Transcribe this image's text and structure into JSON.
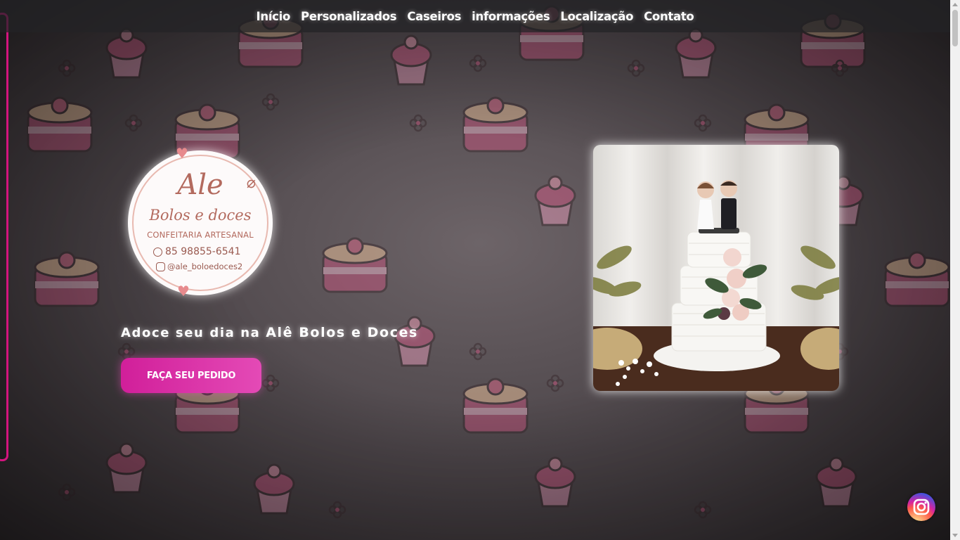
{
  "nav": {
    "items": [
      {
        "label": "Início"
      },
      {
        "label": "Personalizados"
      },
      {
        "label": "Caseiros"
      },
      {
        "label": "informações"
      },
      {
        "label": "Localização"
      },
      {
        "label": "Contato"
      }
    ]
  },
  "logo": {
    "name": "Ale",
    "subtitle": "Bolos e doces",
    "tagline": "CONFEITARIA ARTESANAL",
    "phone": "85 98855-6541",
    "instagram": "@ale_boloedoces2",
    "icons": [
      "heart-icon",
      "whisk-icon",
      "whatsapp-icon",
      "instagram-icon"
    ]
  },
  "hero": {
    "heading_prefix": "Adoce seu dia na ",
    "heading_brand": "Alê Bolos e Doces",
    "cta_label": "FAÇA SEU PEDIDO"
  },
  "floating": {
    "icon": "instagram-icon"
  },
  "colors": {
    "accent": "#d11f9a",
    "accent_light": "#e44ab6",
    "logo_text": "#b36a5e",
    "nav_bg": "#232326",
    "side_border": "#d4147e"
  }
}
